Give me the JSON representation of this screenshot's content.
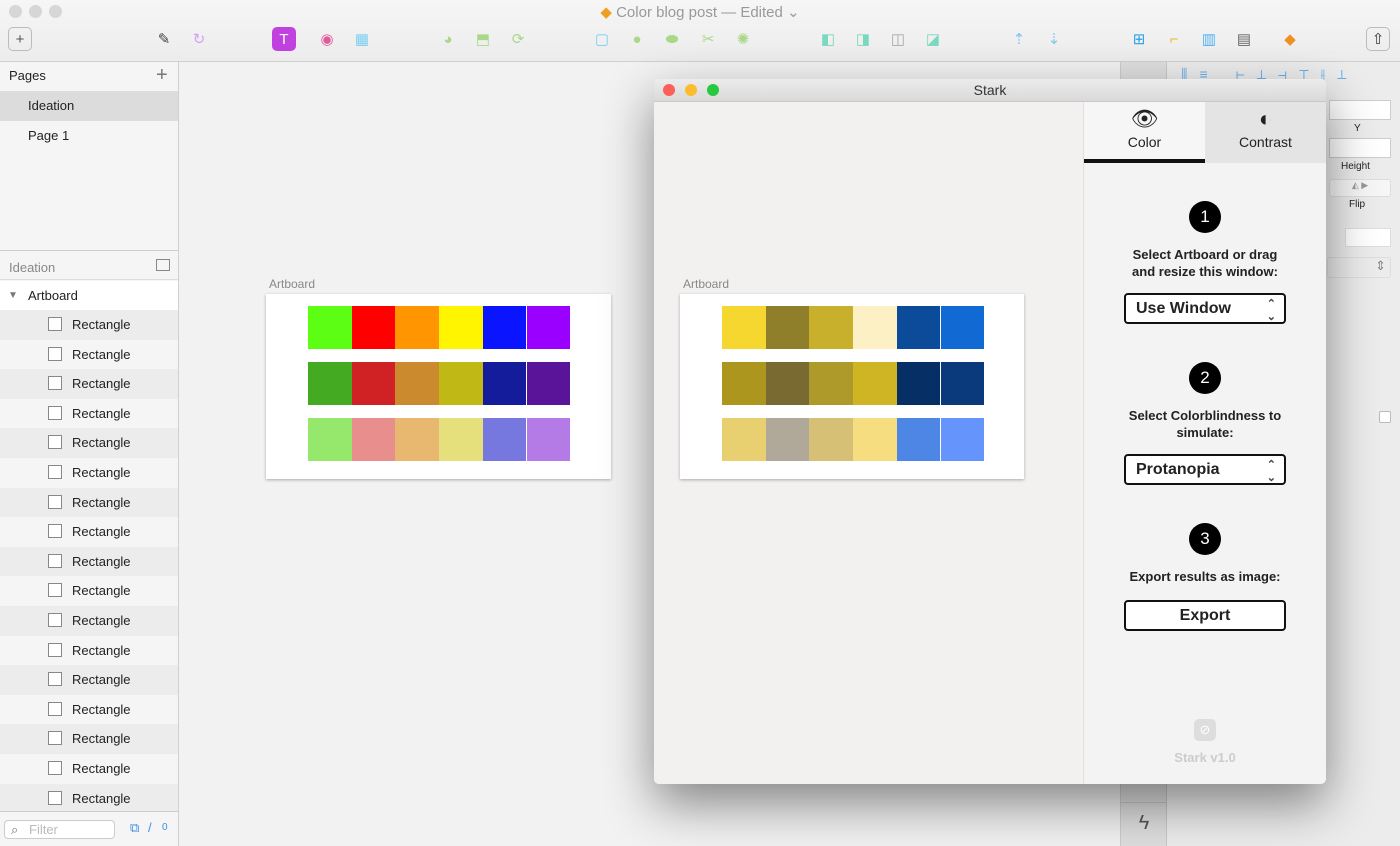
{
  "window": {
    "title": "Color blog post",
    "status": "— Edited"
  },
  "toolbar": {
    "icons": [
      "insert-icon",
      "pen-icon",
      "sync-icon",
      "text-icon",
      "color-wheel-icon",
      "symbols-icon",
      "edit-shape-icon",
      "transform-icon",
      "rotate-icon",
      "mask-icon",
      "union-icon",
      "subtract-icon",
      "scissors-icon",
      "flatten-icon",
      "combine-icon",
      "intersect-icon",
      "difference-icon",
      "exclude-icon",
      "forward-icon",
      "backward-icon",
      "grid-icon",
      "ruler-icon",
      "layout-icon",
      "view-icon",
      "sketch-icon",
      "share-icon"
    ]
  },
  "sidebar": {
    "pages_label": "Pages",
    "pages": [
      {
        "label": "Ideation"
      },
      {
        "label": "Page 1"
      }
    ],
    "current_page": "Ideation",
    "artboard_label": "Artboard",
    "layers": [
      "Rectangle",
      "Rectangle",
      "Rectangle",
      "Rectangle",
      "Rectangle",
      "Rectangle",
      "Rectangle",
      "Rectangle",
      "Rectangle",
      "Rectangle",
      "Rectangle",
      "Rectangle",
      "Rectangle",
      "Rectangle",
      "Rectangle",
      "Rectangle",
      "Rectangle"
    ],
    "filter_placeholder": "Filter",
    "count": "0"
  },
  "canvas": {
    "artboard_label": "Artboard",
    "swatches": [
      [
        "#5cff14",
        "#ff0000",
        "#ff9500",
        "#fff500",
        "#0a14ff",
        "#9a00ff"
      ],
      [
        "#44aa22",
        "#d02224",
        "#cc8a2e",
        "#c0b814",
        "#141c9c",
        "#5a149a"
      ],
      [
        "#96e86c",
        "#e88e8c",
        "#e8b870",
        "#e6e07c",
        "#7678e0",
        "#b47ae6"
      ]
    ]
  },
  "stark": {
    "title": "Stark",
    "artboard_label": "Artboard",
    "swatches": [
      [
        "#f5d730",
        "#8f7e2a",
        "#c9b02c",
        "#fdf0c4",
        "#0b4b9a",
        "#116ad4"
      ],
      [
        "#ad961e",
        "#786a30",
        "#ae9a2a",
        "#cfb524",
        "#062f66",
        "#0b3a7c"
      ],
      [
        "#e8d070",
        "#b0a898",
        "#d6c076",
        "#f5dd80",
        "#4e86e6",
        "#6494fc"
      ]
    ],
    "tabs": {
      "color": "Color",
      "contrast": "Contrast"
    },
    "step1": {
      "num": "1",
      "text": "Select Artboard or drag and resize this window:",
      "select": "Use Window"
    },
    "step2": {
      "num": "2",
      "text": "Select Colorblindness to simulate:",
      "select": "Protanopia"
    },
    "step3": {
      "num": "3",
      "text": "Export results as image:",
      "button": "Export"
    },
    "version": "Stark v1.0"
  },
  "inspector": {
    "y_label": "Y",
    "height_label": "Height",
    "flip_label": "Flip"
  }
}
